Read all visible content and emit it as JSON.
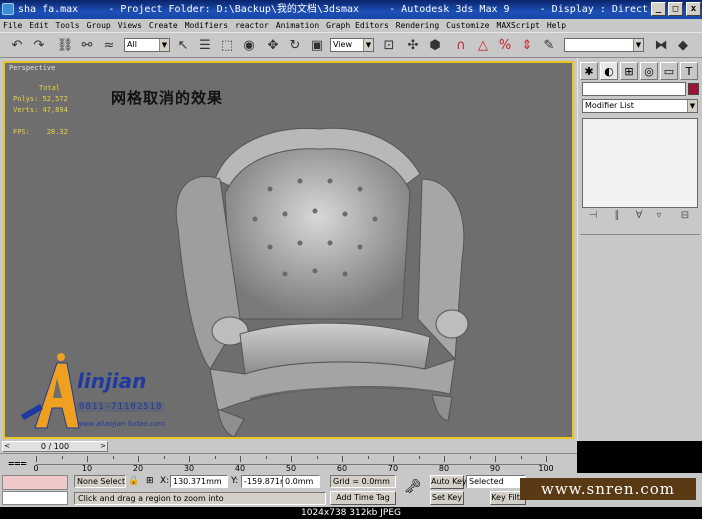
{
  "window": {
    "title": "sha fa.max     - Project Folder: D:\\Backup\\我的文档\\3dsmax     - Autodesk 3ds Max 9     - Display : Direct 3D",
    "minimize": "_",
    "maximize": "□",
    "close": "x"
  },
  "menu": [
    "File",
    "Edit",
    "Tools",
    "Group",
    "Views",
    "Create",
    "Modifiers",
    "reactor",
    "Animation",
    "Graph Editors",
    "Rendering",
    "Customize",
    "MAXScript",
    "Help"
  ],
  "toolbar": {
    "selection_filter": "All",
    "reference_coord": "View",
    "named_selection": ""
  },
  "viewport": {
    "label": "Perspective",
    "stats": {
      "header": "Total",
      "polys_label": "Polys:",
      "polys_value": "52,572",
      "verts_label": "Verts:",
      "verts_value": "47,894",
      "fps_label": "FPS:",
      "fps_value": "28.32"
    },
    "overlay_title": "网格取消的效果",
    "logo_text": "linjian",
    "logo_number": "0811-71102518",
    "logo_url": "www.alianjian.fudao.com"
  },
  "command_panel": {
    "object_name": "",
    "modifier_list": "Modifier List",
    "object_color": "#9a1234"
  },
  "timeline": {
    "frame_display": "0 / 100",
    "prev_arrow": "<",
    "next_arrow": ">",
    "ticks": [
      {
        "frame": 0,
        "label": "0"
      },
      {
        "frame": 10,
        "label": "10"
      },
      {
        "frame": 20,
        "label": "20"
      },
      {
        "frame": 30,
        "label": "30"
      },
      {
        "frame": 40,
        "label": "40"
      },
      {
        "frame": 50,
        "label": "50"
      },
      {
        "frame": 60,
        "label": "60"
      },
      {
        "frame": 70,
        "label": "70"
      },
      {
        "frame": 80,
        "label": "80"
      },
      {
        "frame": 90,
        "label": "90"
      },
      {
        "frame": 100,
        "label": "100"
      }
    ]
  },
  "status": {
    "selection": "None Selecte",
    "x_label": "X:",
    "x_value": "130.371mm",
    "y_label": "Y:",
    "y_value": "-159.871mm",
    "z_label": "Z:",
    "z_value": "0.0mm",
    "grid": "Grid = 0.0mm",
    "add_time_tag": "Add Time Tag",
    "prompt": "Click and drag a region to zoom into",
    "auto_key": "Auto Key",
    "set_key": "Set Key",
    "selected": "Selected",
    "key_filters": "Key Filte"
  },
  "watermark": "www.snren.com",
  "caption": "1024x738  312kb  JPEG"
}
